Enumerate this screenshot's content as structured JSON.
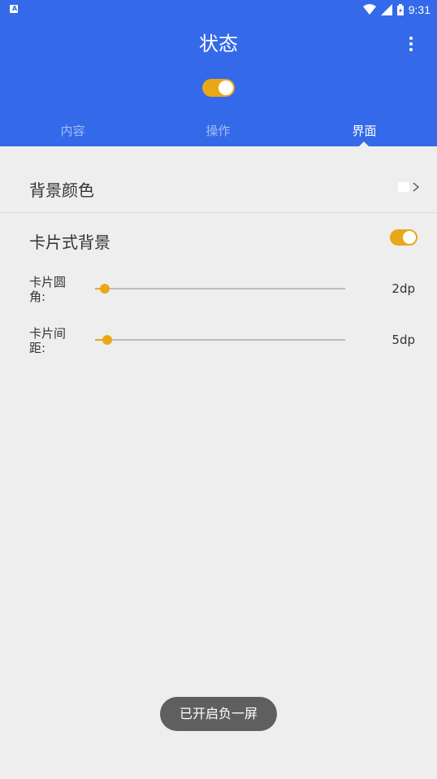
{
  "status_bar": {
    "notification_icon": "A",
    "time": "9:31",
    "icons": [
      "wifi-icon",
      "signal-icon",
      "battery-icon"
    ]
  },
  "header": {
    "title": "状态",
    "master_switch_on": true,
    "menu_icon": "more-vert-icon"
  },
  "tabs": [
    {
      "label": "内容",
      "active": false
    },
    {
      "label": "操作",
      "active": false
    },
    {
      "label": "界面",
      "active": true
    }
  ],
  "settings": {
    "background_color": {
      "label": "背景颜色",
      "swatch_color": "#ffffff"
    },
    "card_background": {
      "label": "卡片式背景",
      "enabled": true
    },
    "card_radius": {
      "label": "卡片圆角:",
      "value": "2dp",
      "level": 0.04
    },
    "card_spacing": {
      "label": "卡片间距:",
      "value": "5dp",
      "level": 0.05
    }
  },
  "toast": {
    "text": "已开启负一屏"
  },
  "colors": {
    "primary": "#346AE9",
    "accent": "#E8A817",
    "background": "#EEEEEE"
  }
}
